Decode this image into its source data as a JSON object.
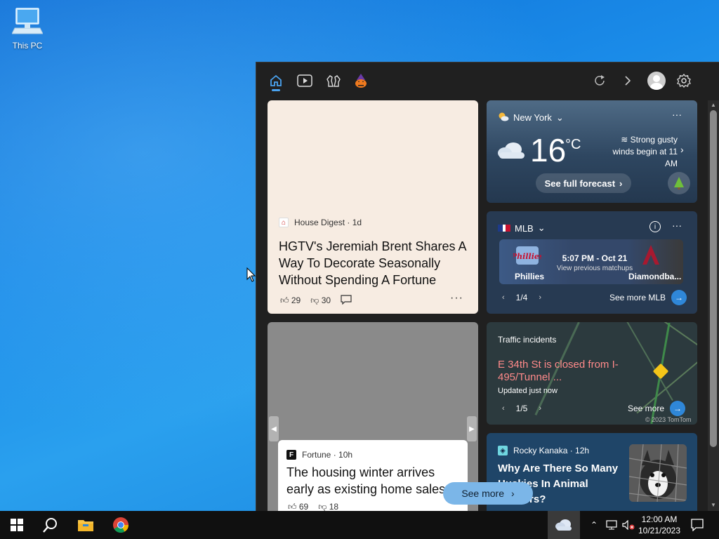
{
  "desktop": {
    "icons": [
      {
        "label": "This PC",
        "icon": "computer-icon"
      }
    ]
  },
  "widgets": {
    "articles": [
      {
        "source": "House Digest · 1d",
        "title": "HGTV's Jeremiah Brent Shares A Way To Decorate Seasonally Without Spending A Fortune",
        "likes": "29",
        "dislikes": "30"
      },
      {
        "source": "Fortune · 10h",
        "title": "The housing winter arrives early as existing home sales",
        "likes": "69",
        "dislikes": "18"
      },
      {
        "source": "Rocky Kanaka · 12h",
        "title": "Why Are There So Many Huskies In Animal Shelters?"
      }
    ],
    "see_more_label": "See more",
    "weather": {
      "location": "New York",
      "temperature": "16",
      "unit": "°C",
      "description": "Strong gusty winds begin at 11 AM",
      "forecast_label": "See full forecast"
    },
    "mlb": {
      "title": "MLB",
      "time": "5:07 PM - Oct 21",
      "subtitle": "View previous matchups",
      "team1": "Phillies",
      "team2": "Diamondba...",
      "pager": "1/4",
      "see_more": "See more MLB"
    },
    "traffic": {
      "header": "Traffic incidents",
      "alert": "E 34th St is closed from I-495/Tunnel ...",
      "updated": "Updated just now",
      "pager": "1/5",
      "see_more": "See more",
      "copyright": "© 2023 TomTom"
    }
  },
  "taskbar": {
    "time": "12:00 AM",
    "date": "10/21/2023"
  },
  "colors": {
    "accent": "#2f87d8",
    "panel_bg": "#202020",
    "alert": "#ff8a8a"
  }
}
